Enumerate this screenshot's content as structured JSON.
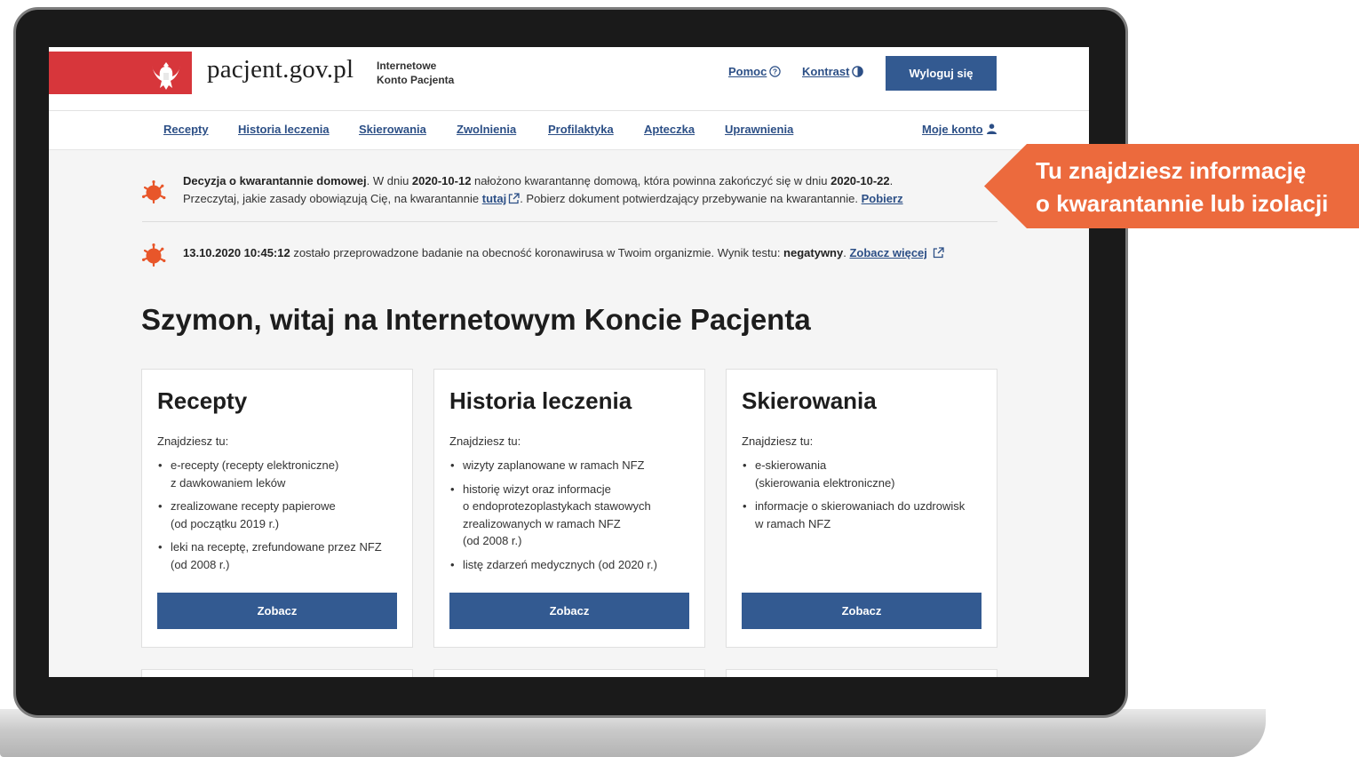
{
  "header": {
    "logo_text": "pacjent.gov.pl",
    "subtitle_line1": "Internetowe",
    "subtitle_line2": "Konto Pacjenta",
    "help_label": "Pomoc",
    "contrast_label": "Kontrast",
    "logout_label": "Wyloguj się"
  },
  "nav": {
    "items": [
      "Recepty",
      "Historia leczenia",
      "Skierowania",
      "Zwolnienia",
      "Profilaktyka",
      "Apteczka",
      "Uprawnienia"
    ],
    "account_label": "Moje konto"
  },
  "notices": {
    "quarantine": {
      "title": "Decyzja o kwarantannie domowej",
      "t1": ". W dniu ",
      "start_date": "2020-10-12",
      "t2": " nałożono kwarantannę domową, która powinna zakończyć się w dniu ",
      "end_date": "2020-10-22",
      "t3": ".",
      "t4": "Przeczytaj, jakie zasady obowiązują Cię, na kwarantannie ",
      "here_link": "tutaj",
      "t5": ". Pobierz dokument potwierdzający przebywanie na kwarantannie. ",
      "download_link": "Pobierz"
    },
    "test": {
      "datetime": "13.10.2020 10:45:12",
      "t1": " zostało przeprowadzone badanie na obecność koronawirusa w Twoim organizmie. Wynik testu: ",
      "result": "negatywny",
      "t2": ". ",
      "more_link": "Zobacz więcej"
    }
  },
  "welcome": "Szymon, witaj na Internetowym Koncie Pacjenta",
  "cards": [
    {
      "title": "Recepty",
      "lead": "Znajdziesz tu:",
      "items": [
        "e-recepty (recepty elektroniczne)\nz dawkowaniem leków",
        "zrealizowane recepty papierowe\n(od początku 2019 r.)",
        "leki na receptę, zrefundowane przez NFZ\n(od 2008 r.)"
      ],
      "button": "Zobacz"
    },
    {
      "title": "Historia leczenia",
      "lead": "Znajdziesz tu:",
      "items": [
        "wizyty zaplanowane w ramach NFZ",
        "historię wizyt oraz informacje\no endoprotezoplastykach stawowych\nzrealizowanych w ramach NFZ\n(od 2008 r.)",
        "listę zdarzeń medycznych (od 2020 r.)"
      ],
      "button": "Zobacz"
    },
    {
      "title": "Skierowania",
      "lead": "Znajdziesz tu:",
      "items": [
        "e-skierowania\n(skierowania elektroniczne)",
        "informacje o skierowaniach do uzdrowisk\nw ramach NFZ"
      ],
      "button": "Zobacz"
    }
  ],
  "callout": {
    "text": "Tu znajdziesz informację\no kwarantannie lub izolacji",
    "color": "#ec6a3d"
  },
  "colors": {
    "primary": "#335a91",
    "link": "#2c4f86",
    "flag_red": "#d7363b",
    "virus": "#e8562a"
  }
}
